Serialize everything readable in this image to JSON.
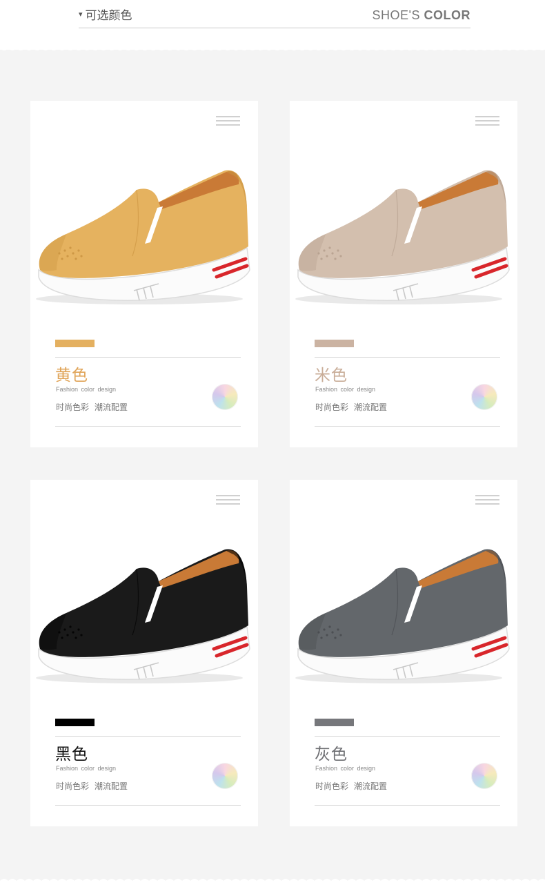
{
  "header": {
    "left_marker": "▾",
    "left_label": "可选颜色",
    "right_label_light": "SHOE'S",
    "right_label_bold": "COLOR"
  },
  "colors": {
    "card_bg": "#ffffff",
    "page_bg": "#f4f4f4",
    "sole_stripe": "#d8262b"
  },
  "cards": [
    {
      "name": "黄色",
      "subtitle_en": "Fashion color design",
      "tag1": "时尚色彩",
      "tag2": "潮流配置",
      "swatch": "#e4b060",
      "name_color": "#e0a458",
      "upper": "#e5b25f",
      "upper_dark": "#c9923f"
    },
    {
      "name": "米色",
      "subtitle_en": "Fashion color design",
      "tag1": "时尚色彩",
      "tag2": "潮流配置",
      "swatch": "#cbb3a2",
      "name_color": "#c9ad98",
      "upper": "#d3bfae",
      "upper_dark": "#b49e8c"
    },
    {
      "name": "黑色",
      "subtitle_en": "Fashion color design",
      "tag1": "时尚色彩",
      "tag2": "潮流配置",
      "swatch": "#000000",
      "name_color": "#111111",
      "upper": "#1a1a1a",
      "upper_dark": "#000000"
    },
    {
      "name": "灰色",
      "subtitle_en": "Fashion color design",
      "tag1": "时尚色彩",
      "tag2": "潮流配置",
      "swatch": "#76777b",
      "name_color": "#6e6f73",
      "upper": "#63676b",
      "upper_dark": "#474a4e"
    }
  ]
}
